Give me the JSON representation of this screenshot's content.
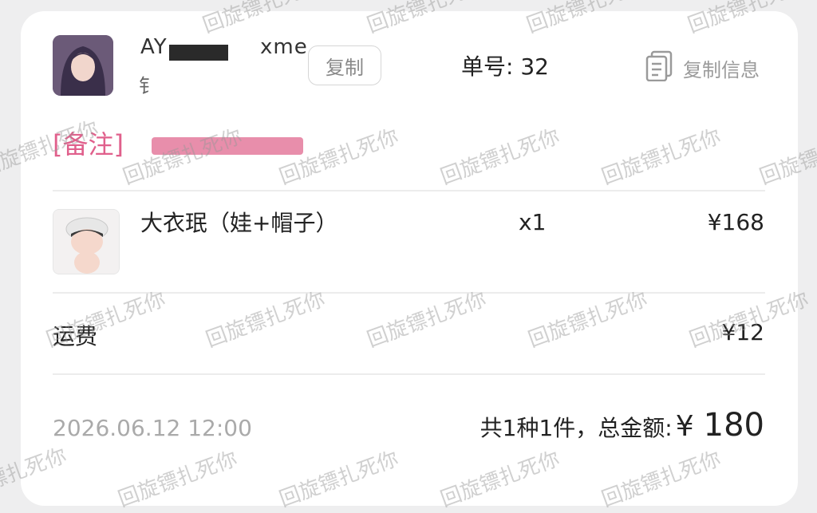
{
  "header": {
    "user_name": "AY",
    "user_name_tail": "xme",
    "user_sub": "钅",
    "copy_button": "复制",
    "order_number": "单号: 32",
    "copy_info": "复制信息"
  },
  "note": {
    "label": "[备注]"
  },
  "item": {
    "name": "大衣珉（娃+帽子）",
    "quantity": "x1",
    "price": "¥168"
  },
  "shipping": {
    "label": "运费",
    "price": "¥12"
  },
  "footer": {
    "timestamp": "2026.06.12 12:00",
    "summary_label": "共1种1件，总金额:",
    "currency": "¥",
    "total": "180"
  },
  "watermark": {
    "text": "回旋镖扎死你"
  },
  "colors": {
    "note_pink": "#e0608c",
    "card_bg": "#ffffff",
    "page_bg": "#eeeeef"
  },
  "icons": {
    "copy_info_icon": "document-copy-icon"
  }
}
